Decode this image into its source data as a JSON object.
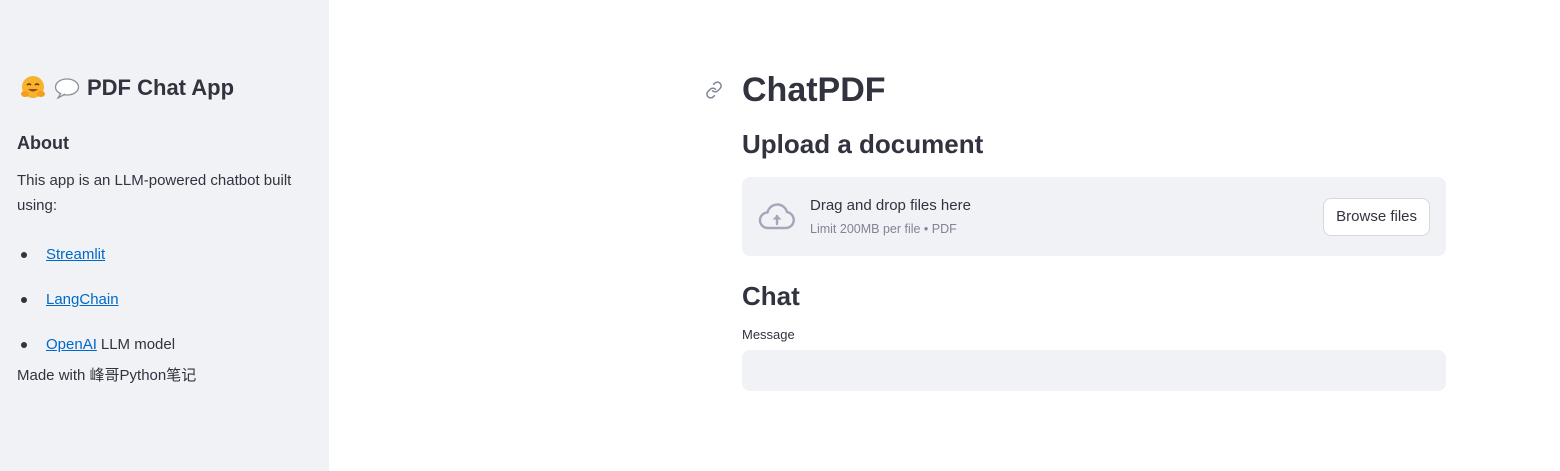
{
  "sidebar": {
    "title": "PDF Chat App",
    "title_icons": [
      "hugging-face-emoji",
      "speech-bubble-emoji"
    ],
    "about_heading": "About",
    "about_text": "This app is an LLM-powered chatbot built using:",
    "links": [
      {
        "label": "Streamlit",
        "suffix": ""
      },
      {
        "label": "LangChain",
        "suffix": ""
      },
      {
        "label": "OpenAI",
        "suffix": "LLM model"
      }
    ],
    "made_with": "Made with 峰哥Python笔记"
  },
  "main": {
    "title": "ChatPDF",
    "upload_heading": "Upload a document",
    "uploader": {
      "icon": "cloud-upload-icon",
      "drag_text": "Drag and drop files here",
      "limit_text": "Limit 200MB per file • PDF",
      "browse_label": "Browse files"
    },
    "chat_heading": "Chat",
    "message_label": "Message",
    "message_value": ""
  },
  "colors": {
    "sidebar_bg": "#f0f2f6",
    "text": "#31333f",
    "link": "#0068c9",
    "muted": "#808495"
  }
}
